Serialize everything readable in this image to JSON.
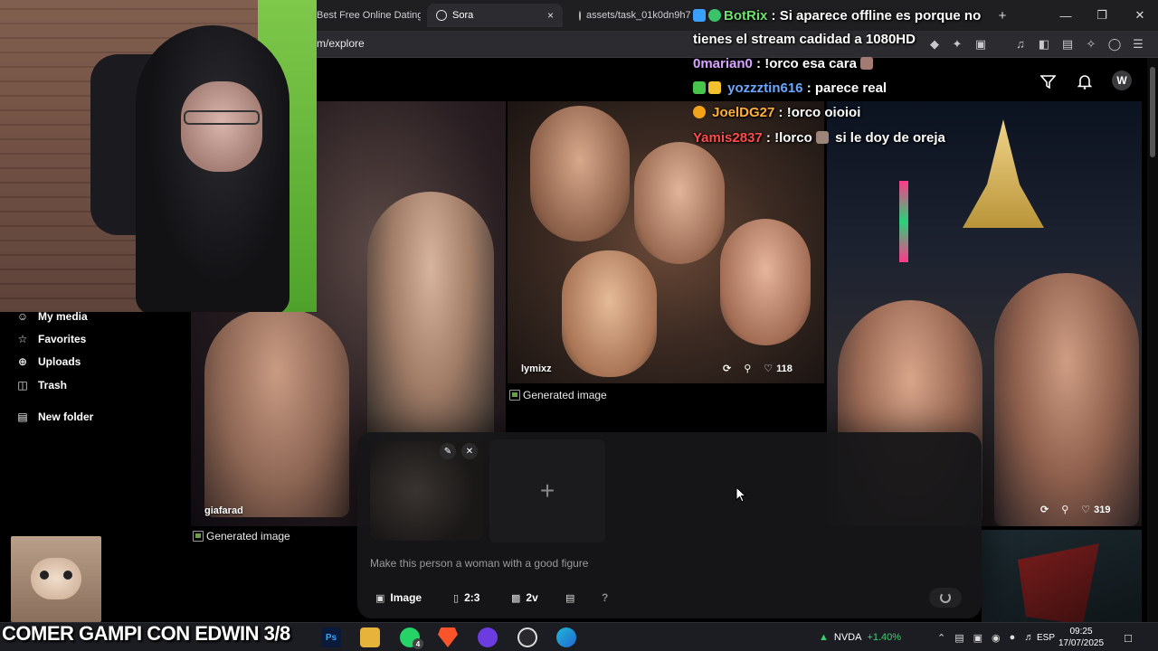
{
  "browser": {
    "tabs": [
      {
        "label": "Best Free Online Dating"
      },
      {
        "label": "Sora"
      },
      {
        "label": "assets/task_01k0dn9h7"
      }
    ],
    "url": "m/explore",
    "new_tab_symbol": "+",
    "tab_close_symbol": "×"
  },
  "sidebar": {
    "items": [
      {
        "label": "My media",
        "icon": "user-icon"
      },
      {
        "label": "Favorites",
        "icon": "star-icon"
      },
      {
        "label": "Uploads",
        "icon": "upload-icon"
      },
      {
        "label": "Trash",
        "icon": "trash-icon"
      },
      {
        "label": "New folder",
        "icon": "folder-plus-icon"
      }
    ]
  },
  "header": {
    "avatar_letter": "W"
  },
  "feed": {
    "tiles": [
      {
        "user": "giafarad"
      },
      {
        "user": "lymixz",
        "likes": "118"
      },
      {
        "user": "",
        "likes": "319"
      }
    ],
    "generated_label": "Generated image"
  },
  "composer": {
    "prompt": "Make this person a woman with a good figure",
    "add_symbol": "+",
    "options": {
      "type_label": "Image",
      "aspect_label": "2:3",
      "variations_label": "2v",
      "help_label": "?"
    }
  },
  "chat": {
    "messages": [
      {
        "user": "BotRix",
        "color": "#6fe06f",
        "text": "Si aparece offline es porque no"
      },
      {
        "user": "",
        "color": "#ffffff",
        "text": "tienes el stream cadidad a 1080HD"
      },
      {
        "user": "0marian0",
        "color": "#d8a3ff",
        "text": "!orco esa cara"
      },
      {
        "user": "yozzztin616",
        "color": "#6aa8ff",
        "text": "parece real"
      },
      {
        "user": "JoelDG27",
        "color": "#ffb03b",
        "text": "!orco oioioi"
      },
      {
        "user": "Yamis2837",
        "color": "#ff4b4b",
        "text": "!lorco",
        "tail": "si le doy de oreja"
      }
    ]
  },
  "stream": {
    "title": "COMER GAMPI CON EDWIN 3/8"
  },
  "taskbar": {
    "ticker": "NVDA",
    "change": "+1.40%",
    "language": "ESP",
    "time": "09:25",
    "date": "17/07/2025",
    "whatsapp_badge": "4"
  },
  "colors": {
    "ticker_up": "#3ecf6c",
    "accent_green": "#6fe06f"
  }
}
